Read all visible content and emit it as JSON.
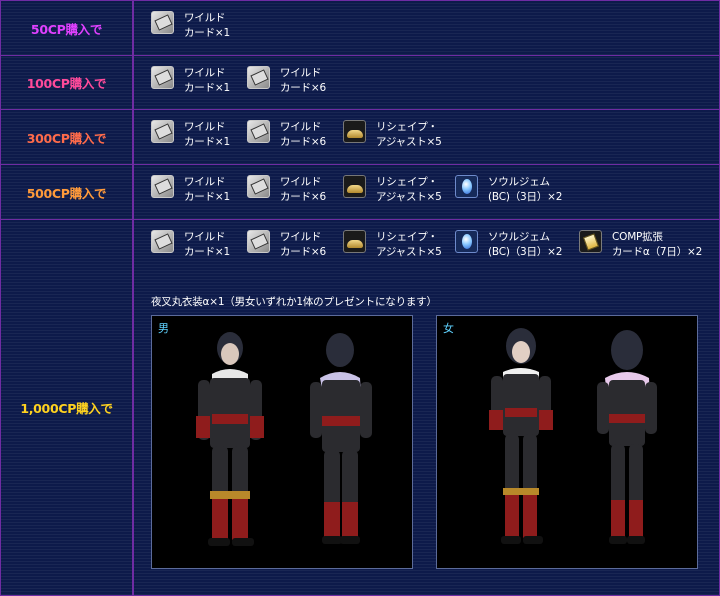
{
  "rows": [
    {
      "label": "50CP購入で",
      "label_color": "#e040ff",
      "items": [
        {
          "icon": "card-icon",
          "name": "ワイルド\nカード×1"
        }
      ]
    },
    {
      "label": "100CP購入で",
      "label_color": "#ff4a9a",
      "items": [
        {
          "icon": "card-icon",
          "name": "ワイルド\nカード×1"
        },
        {
          "icon": "card-icon",
          "name": "ワイルド\nカード×6"
        }
      ]
    },
    {
      "label": "300CP購入で",
      "label_color": "#ff6b4a",
      "items": [
        {
          "icon": "card-icon",
          "name": "ワイルド\nカード×1"
        },
        {
          "icon": "card-icon",
          "name": "ワイルド\nカード×6"
        },
        {
          "icon": "lamp-icon",
          "name": "リシェイプ・\nアジャスト×5"
        }
      ]
    },
    {
      "label": "500CP購入で",
      "label_color": "#ff9a3a",
      "items": [
        {
          "icon": "card-icon",
          "name": "ワイルド\nカード×1"
        },
        {
          "icon": "card-icon",
          "name": "ワイルド\nカード×6"
        },
        {
          "icon": "lamp-icon",
          "name": "リシェイプ・\nアジャスト×5"
        },
        {
          "icon": "gem-icon",
          "name": "ソウルジェム\n(BC)（3日）×2"
        }
      ]
    },
    {
      "label": "1,000CP購入で",
      "label_color": "#ffd21f",
      "items": [
        {
          "icon": "card-icon",
          "name": "ワイルド\nカード×1"
        },
        {
          "icon": "card-icon",
          "name": "ワイルド\nカード×6"
        },
        {
          "icon": "lamp-icon",
          "name": "リシェイプ・\nアジャスト×5"
        },
        {
          "icon": "gem-icon",
          "name": "ソウルジェム\n(BC)（3日）×2"
        },
        {
          "icon": "comp-icon",
          "name": "COMP拡張\nカードα（7日）×2"
        }
      ],
      "caption": "夜叉丸衣装α×1（男女いずれか1体のプレゼントになります）",
      "portraits": [
        {
          "label": "男"
        },
        {
          "label": "女"
        }
      ]
    }
  ]
}
